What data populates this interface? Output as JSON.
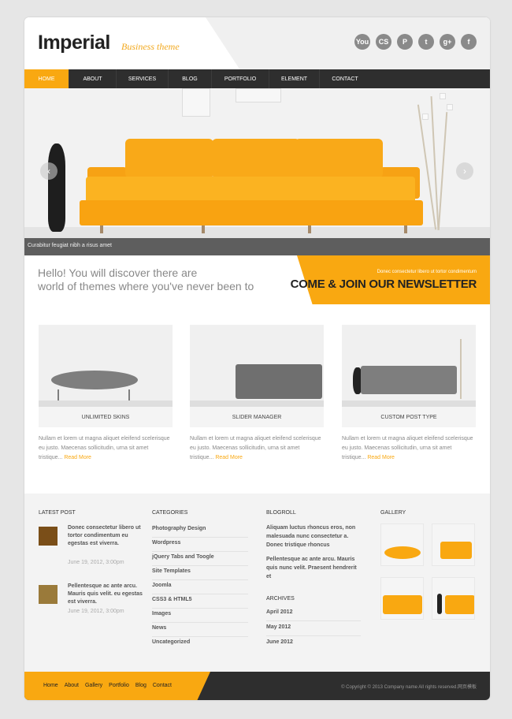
{
  "header": {
    "logo": "Imperial",
    "tagline": "Business theme",
    "social": [
      {
        "icon": "youtube-icon",
        "glyph": "You"
      },
      {
        "icon": "lastfm-icon",
        "glyph": "CS"
      },
      {
        "icon": "pinterest-icon",
        "glyph": "P"
      },
      {
        "icon": "twitter-icon",
        "glyph": "t"
      },
      {
        "icon": "google-plus-icon",
        "glyph": "g+"
      },
      {
        "icon": "facebook-icon",
        "glyph": "f"
      }
    ]
  },
  "nav": {
    "items": [
      "HOME",
      "ABOUT",
      "SERVICES",
      "BLOG",
      "PORTFOLIO",
      "ELEMENT",
      "CONTACT"
    ],
    "active": "HOME"
  },
  "slider": {
    "caption": "Curabitur feugiat nibh a risus amet",
    "prev": "‹",
    "next": "›"
  },
  "intro": {
    "line1": "Hello! You will discover there are",
    "line2": "world of themes where you've never been to"
  },
  "newsletter": {
    "small": "Donec consectetur libero ut tortor condimentum",
    "big": "COME & JOIN OUR NEWSLETTER"
  },
  "features": [
    {
      "label": "UNLIMITED SKINS",
      "text": "Nullam et lorem ut magna aliquet eleifend scelerisque eu justo. Maecenas sollicitudin, urna sit amet tristique...",
      "more": "Read More"
    },
    {
      "label": "SLIDER MANAGER",
      "text": "Nullam et lorem ut magna aliquet eleifend scelerisque eu justo. Maecenas sollicitudin, urna sit amet tristique...",
      "more": "Read More"
    },
    {
      "label": "CUSTOM POST TYPE",
      "text": "Nullam et lorem ut magna aliquet eleifend scelerisque eu justo. Maecenas sollicitudin, urna sit amet tristique...",
      "more": "Read More"
    }
  ],
  "widgets": {
    "latest_title": "LATEST POST",
    "posts": [
      {
        "title": "Donec consectetur libero ut tortor condimentum eu egestas est viverra.",
        "date": "June 19, 2012, 3:00pm"
      },
      {
        "title": "Pellentesque ac ante arcu. Mauris quis velit. eu egestas est viverra.",
        "date": "June 19, 2012, 3:00pm"
      }
    ],
    "categories_title": "CATEGORIES",
    "categories": [
      "Photography Design",
      "Wordpress",
      "jQuery Tabs and Toogle",
      "Site Templates",
      "Joomla",
      "CSS3 & HTML5",
      "Images",
      "News",
      "Uncategorized"
    ],
    "blogroll_title": "BLOGROLL",
    "blogroll": [
      "Aliquam luctus rhoncus eros, non malesuada nunc consectetur a. Donec tristique rhoncus",
      "Pellentesque ac ante arcu. Mauris quis nunc velit. Praesent hendrerit et"
    ],
    "archives_title": "ARCHIVES",
    "archives": [
      "April 2012",
      "May 2012",
      "June 2012"
    ],
    "gallery_title": "GALLERY"
  },
  "footer": {
    "links": [
      "Home",
      "About",
      "Gallery",
      "Portfolio",
      "Blog",
      "Contact"
    ],
    "copyright": "© Copyright © 2013 Company name All rights reserved.网页模板"
  },
  "colors": {
    "accent": "#f9a811",
    "dark": "#2e2e2e"
  }
}
